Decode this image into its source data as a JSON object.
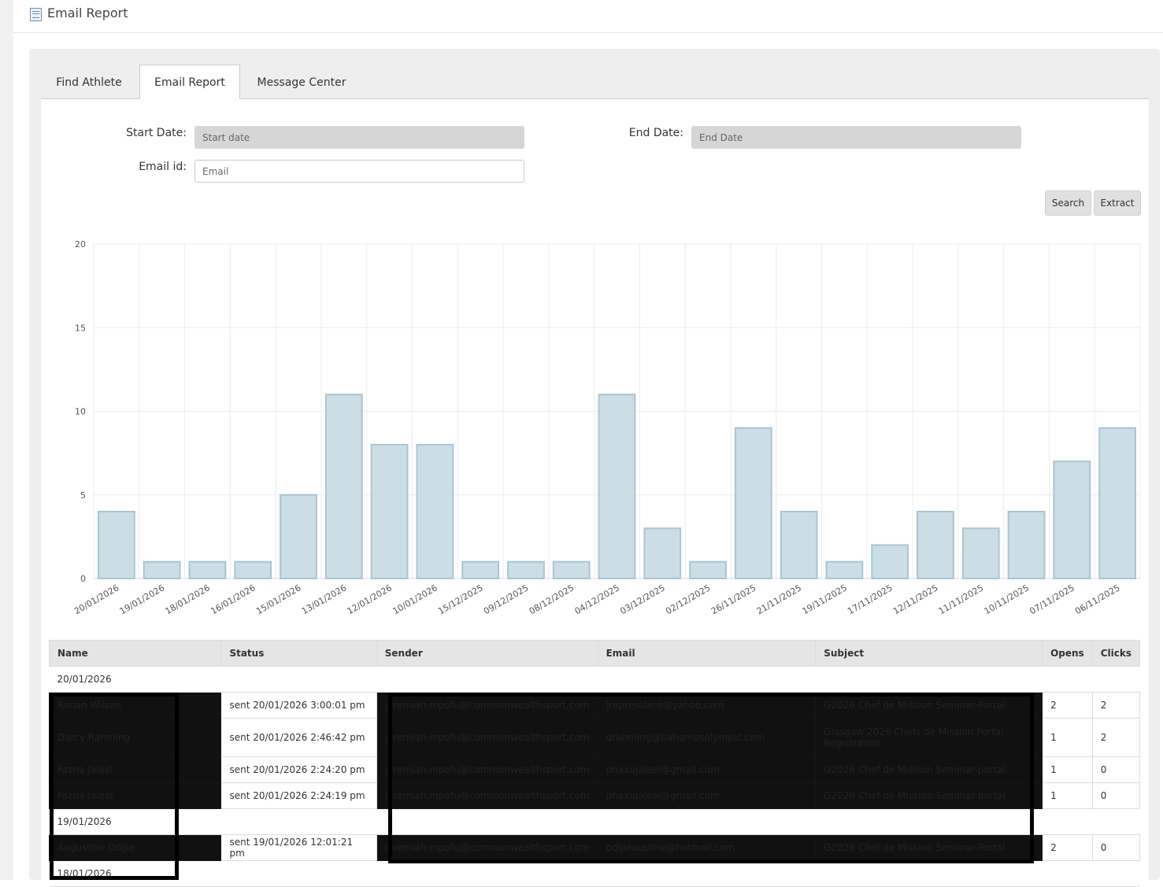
{
  "header": {
    "title": "Email Report"
  },
  "tabs": [
    {
      "label": "Find Athlete"
    },
    {
      "label": "Email Report",
      "active": true
    },
    {
      "label": "Message Center"
    }
  ],
  "form": {
    "start_label": "Start Date:",
    "start_placeholder": "Start date",
    "end_label": "End Date:",
    "end_placeholder": "End Date",
    "email_label": "Email id:",
    "email_placeholder": "Email",
    "search": "Search",
    "extract": "Extract"
  },
  "chart_data": {
    "type": "bar",
    "categories": [
      "20/01/2026",
      "19/01/2026",
      "18/01/2026",
      "16/01/2026",
      "15/01/2026",
      "13/01/2026",
      "12/01/2026",
      "10/01/2026",
      "15/12/2025",
      "09/12/2025",
      "08/12/2025",
      "04/12/2025",
      "03/12/2025",
      "02/12/2025",
      "26/11/2025",
      "21/11/2025",
      "19/11/2025",
      "17/11/2025",
      "12/11/2025",
      "11/11/2025",
      "10/11/2025",
      "07/11/2025",
      "06/11/2025"
    ],
    "values": [
      4,
      1,
      1,
      1,
      5,
      11,
      8,
      8,
      1,
      1,
      1,
      11,
      3,
      1,
      9,
      4,
      1,
      2,
      4,
      3,
      4,
      7,
      9
    ],
    "ylim": [
      0,
      20
    ],
    "yticks": [
      0,
      5,
      10,
      15,
      20
    ],
    "grid": true,
    "bar_color": "#cbdde5",
    "bar_border": "#a9c5d3"
  },
  "table": {
    "columns": [
      "Name",
      "Status",
      "Sender",
      "Email",
      "Subject",
      "Opens",
      "Clicks"
    ],
    "rows": [
      {
        "type": "date",
        "label": "20/01/2026"
      },
      {
        "name": "Rohan Wilson",
        "status": "sent 20/01/2026 3:00:01 pm",
        "sender": "jeremiah.mpofu@commonwealthsport.com",
        "email": "jrapresident@yahoo.com",
        "subject": "G2026 Chef de Mission Seminar-Portal",
        "opens": "2",
        "clicks": "2"
      },
      {
        "name": "Darcy Rahming",
        "status": "sent 20/01/2026 2:46:42 pm",
        "sender": "jeremiah.mpofu@commonwealthsport.com",
        "email": "drahming@bahamasolympic.com",
        "subject": "Glasgow 2026 Chefs de Mission Portal Registration",
        "opens": "1",
        "clicks": "2"
      },
      {
        "name": "Fazna Jaleel",
        "status": "sent 20/01/2026 2:24:20 pm",
        "sender": "jeremiah.mpofu@commonwealthsport.com",
        "email": "phaxujaleel@gmail.com",
        "subject": "G2026 Chef de Mission Seminar-portal",
        "opens": "1",
        "clicks": "0"
      },
      {
        "name": "Fazna Jaleel",
        "status": "sent 20/01/2026 2:24:19 pm",
        "sender": "jeremiah.mpofu@commonwealthsport.com",
        "email": "phaxujaleel@gmail.com",
        "subject": "G2026 Chef de Mission Seminar-portal",
        "opens": "1",
        "clicks": "0"
      },
      {
        "type": "date",
        "label": "19/01/2026"
      },
      {
        "name": "Augustine Odijie",
        "status": "sent 19/01/2026 12:01:21 pm",
        "sender": "jeremiah.mpofu@commonwealthsport.com",
        "email": "odijieaustine@hotmail.com",
        "subject": "G2026 Chef de Mission Seminar-Portal",
        "opens": "2",
        "clicks": "0"
      },
      {
        "type": "date",
        "label": "18/01/2026"
      }
    ]
  }
}
